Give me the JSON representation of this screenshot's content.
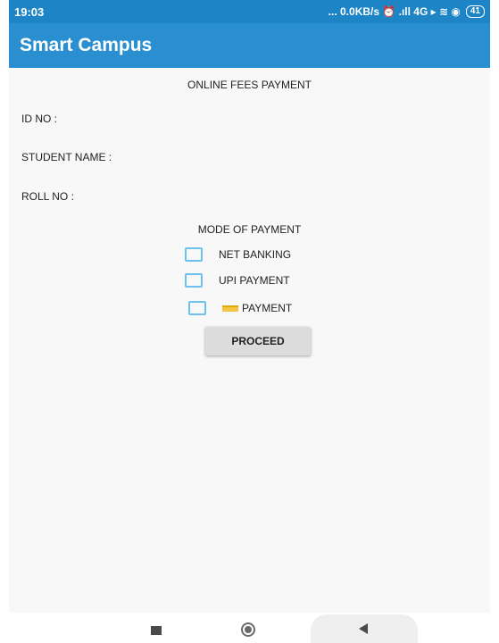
{
  "status_bar": {
    "time": "19:03",
    "indicators": "... 0.0KB/s ⏰ .ıll 4G ▸ ≋ ◉",
    "battery": "41"
  },
  "app_bar": {
    "title": "Smart Campus"
  },
  "screen": {
    "title": "ONLINE FEES PAYMENT",
    "fields": {
      "id_label": "ID NO :",
      "name_label": "STUDENT NAME :",
      "roll_label": "ROLL NO :"
    },
    "mode_title": "MODE OF PAYMENT",
    "options": [
      {
        "label": "NET BANKING",
        "checked": false
      },
      {
        "label": "UPI PAYMENT",
        "checked": false
      },
      {
        "label": "PAYMENT",
        "checked": false,
        "icon": "card-icon"
      }
    ],
    "proceed_label": "PROCEED"
  },
  "nav_bar": {
    "icons": [
      "recents-square-icon",
      "home-circle-icon",
      "back-triangle-icon"
    ]
  },
  "colors": {
    "status_bar": "#1d84c6",
    "app_bar": "#2a8fd0",
    "checkbox_border": "#6ec1ec",
    "button_bg": "#dcdcdc"
  }
}
